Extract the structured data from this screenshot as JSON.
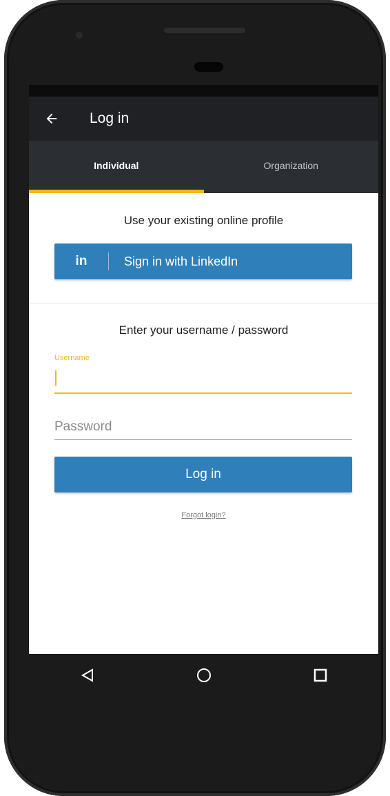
{
  "app_bar": {
    "title": "Log in",
    "back_icon": "arrow-left-icon"
  },
  "tabs": [
    {
      "label": "Individual",
      "active": true
    },
    {
      "label": "Organization",
      "active": false
    }
  ],
  "colors": {
    "accent": "#f3b817",
    "button": "#2f7fba",
    "app_bar": "#1f2124",
    "tab_bar": "#2b2e32"
  },
  "profile_section": {
    "heading": "Use your existing online profile",
    "linkedin_icon": "in",
    "linkedin_label": "Sign in with LinkedIn"
  },
  "credentials_section": {
    "heading": "Enter your username / password",
    "username_label": "Username",
    "username_value": "",
    "password_placeholder": "Password",
    "login_button": "Log in",
    "forgot_link": "Forgot login?"
  },
  "nav_bar": {
    "back_icon": "triangle-back-icon",
    "home_icon": "circle-home-icon",
    "recents_icon": "square-recents-icon"
  }
}
